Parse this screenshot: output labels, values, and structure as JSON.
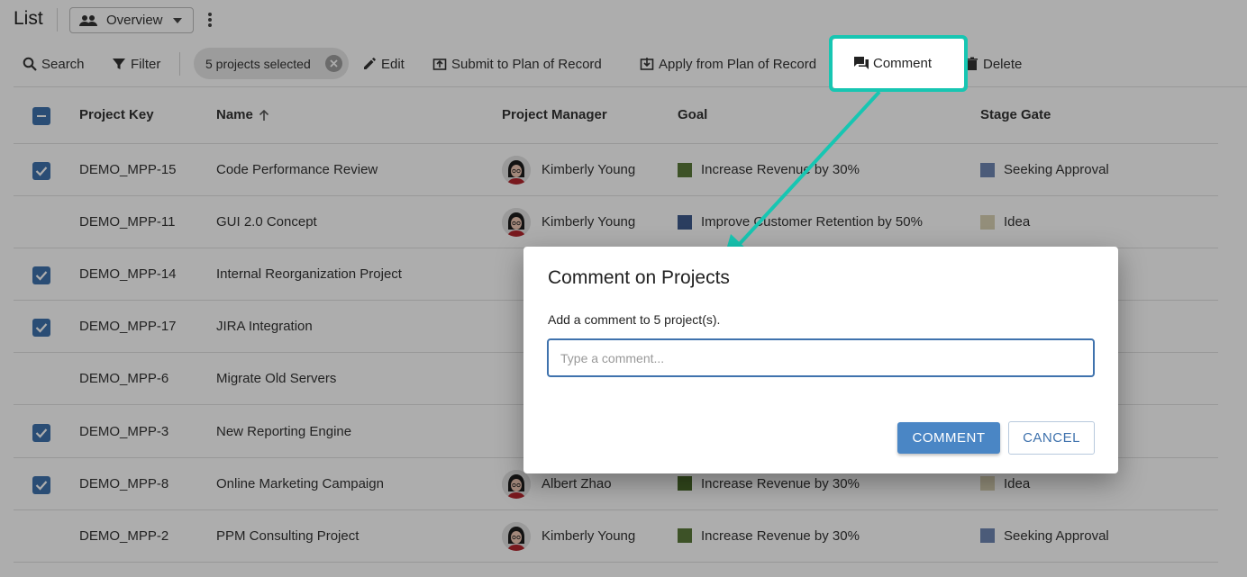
{
  "header": {
    "title": "List",
    "view_label": "Overview"
  },
  "toolbar": {
    "search": "Search",
    "filter": "Filter",
    "selection_chip": "5 projects selected",
    "edit": "Edit",
    "submit": "Submit to Plan of Record",
    "apply": "Apply from Plan of Record",
    "comment": "Comment",
    "delete": "Delete"
  },
  "table": {
    "columns": {
      "key": "Project Key",
      "name": "Name",
      "manager": "Project Manager",
      "goal": "Goal",
      "stage": "Stage Gate"
    },
    "rows": [
      {
        "checked": true,
        "key": "DEMO_MPP-15",
        "name": "Code Performance Review",
        "manager": "Kimberly Young",
        "goal": "Increase Revenue by 30%",
        "goal_color": "#5a7a3a",
        "stage": "Seeking Approval",
        "stage_color": "#6f86b3"
      },
      {
        "checked": false,
        "key": "DEMO_MPP-11",
        "name": "GUI 2.0 Concept",
        "manager": "Kimberly Young",
        "goal": "Improve Customer Retention by 50%",
        "goal_color": "#3f5b8c",
        "stage": "Idea",
        "stage_color": "#d9d2b4"
      },
      {
        "checked": true,
        "key": "DEMO_MPP-14",
        "name": "Internal Reorganization Project",
        "manager": "",
        "goal": "",
        "goal_color": "",
        "stage": "",
        "stage_color": ""
      },
      {
        "checked": true,
        "key": "DEMO_MPP-17",
        "name": "JIRA Integration",
        "manager": "",
        "goal": "",
        "goal_color": "",
        "stage": "",
        "stage_color": ""
      },
      {
        "checked": false,
        "key": "DEMO_MPP-6",
        "name": "Migrate Old Servers",
        "manager": "",
        "goal": "",
        "goal_color": "",
        "stage": "",
        "stage_color": ""
      },
      {
        "checked": true,
        "key": "DEMO_MPP-3",
        "name": "New Reporting Engine",
        "manager": "",
        "goal": "",
        "goal_color": "",
        "stage": "",
        "stage_color": ""
      },
      {
        "checked": true,
        "key": "DEMO_MPP-8",
        "name": "Online Marketing Campaign",
        "manager": "Albert Zhao",
        "goal": "Increase Revenue by 30%",
        "goal_color": "#4a6a2a",
        "stage": "Idea",
        "stage_color": "#d9d2b4"
      },
      {
        "checked": false,
        "key": "DEMO_MPP-2",
        "name": "PPM Consulting Project",
        "manager": "Kimberly Young",
        "goal": "Increase Revenue by 30%",
        "goal_color": "#5a7a3a",
        "stage": "Seeking Approval",
        "stage_color": "#6f86b3"
      }
    ]
  },
  "dialog": {
    "title": "Comment on Projects",
    "description": "Add a comment to 5 project(s).",
    "placeholder": "Type a comment...",
    "confirm": "COMMENT",
    "cancel": "CANCEL"
  },
  "colors": {
    "accent": "#3f72ad",
    "highlight": "#17c6b2",
    "primary_button": "#4a86c5"
  }
}
